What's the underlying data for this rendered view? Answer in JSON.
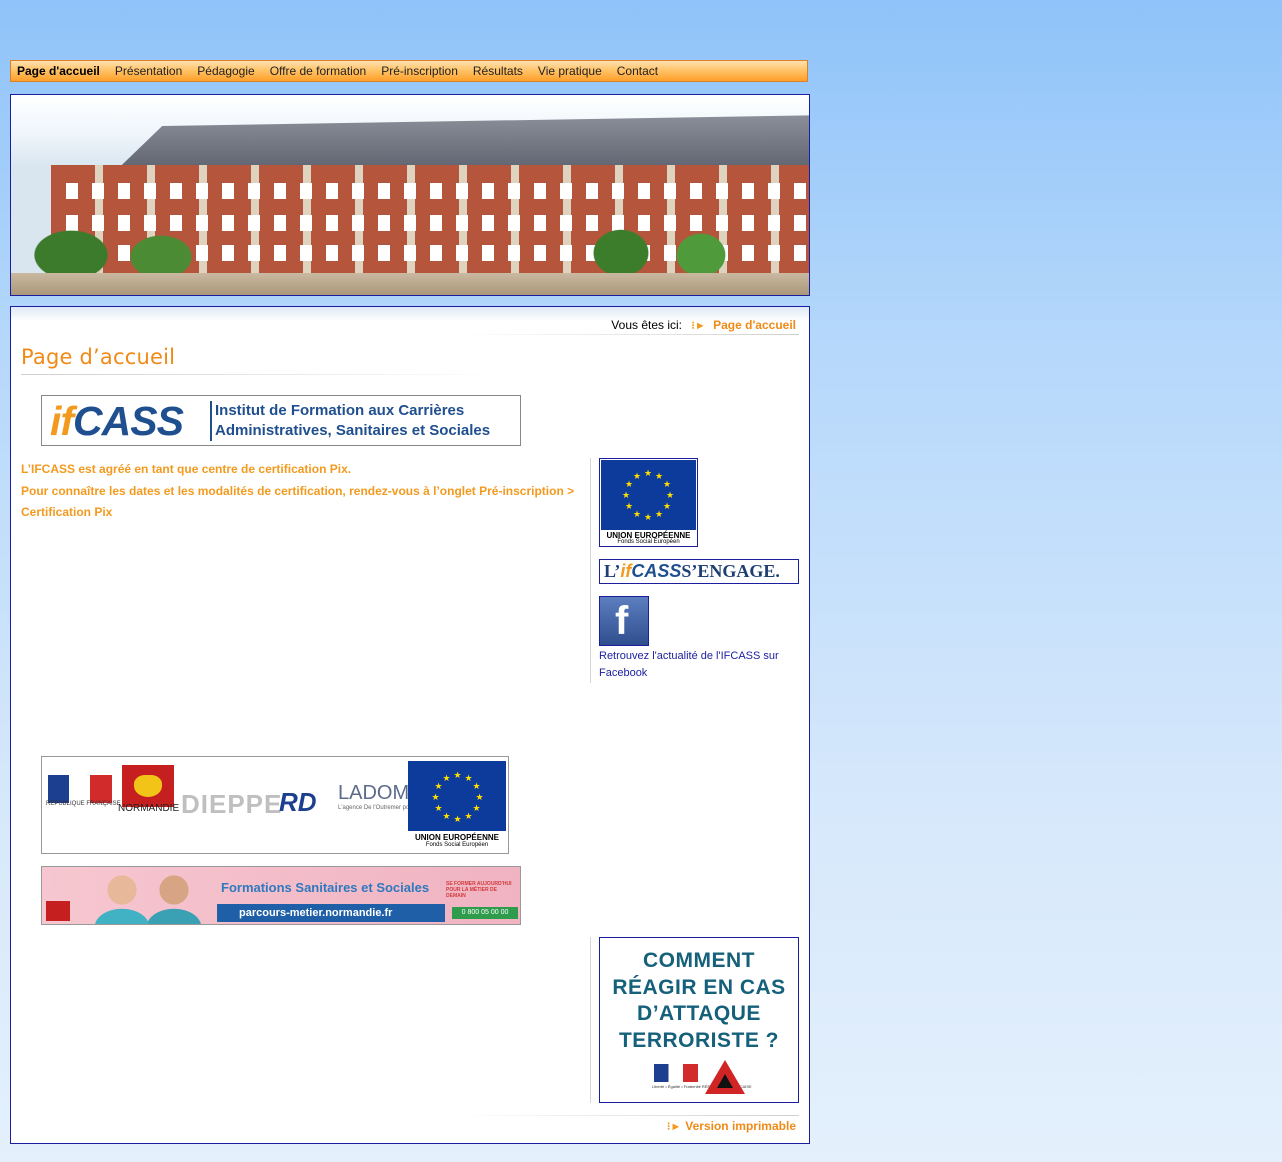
{
  "nav": {
    "items": [
      {
        "label": "Page d'accueil"
      },
      {
        "label": "Présentation"
      },
      {
        "label": "Pédagogie"
      },
      {
        "label": "Offre de formation"
      },
      {
        "label": "Pré-inscription"
      },
      {
        "label": "Résultats"
      },
      {
        "label": "Vie pratique"
      },
      {
        "label": "Contact"
      }
    ],
    "active_index": 0
  },
  "breadcrumb": {
    "prefix": "Vous êtes ici:",
    "current": "Page d'accueil"
  },
  "page_title": "Page d’accueil",
  "logo": {
    "mark_if": "if",
    "mark_cass": "CASS",
    "tagline_1": "Institut de Formation aux Carrières",
    "tagline_2": "Administratives, Sanitaires et Sociales"
  },
  "info": {
    "line_1": "L’IFCASS est agréé en tant que centre de certification Pix.",
    "line_2": "Pour connaître les dates et les modalités de certification, rendez-vous à l’onglet Pré-inscription > Certification Pix"
  },
  "sidebar": {
    "eu_caption_1": "UNION EUROPÉENNE",
    "eu_caption_2": "Fonds Social Européen",
    "engage_prefix": "L’",
    "engage_if": "if",
    "engage_cass": "CASS",
    "engage_suffix": " S’ENGAGE.",
    "facebook_glyph": "f",
    "facebook_text": "Retrouvez l'actualité de l'IFCASS sur Facebook",
    "terror_line_1": "COMMENT",
    "terror_line_2": "RÉAGIR EN CAS",
    "terror_line_3": "D’ATTAQUE",
    "terror_line_4": "TERRORISTE ?",
    "terror_rf": "Liberté • Égalité • Fraternité  RÉPUBLIQUE FRANÇAISE"
  },
  "partners": {
    "rf_text": "RÉPUBLIQUE FRANÇAISE",
    "normandie": "NORMANDIE",
    "dieppe": "DIEPPE",
    "rd": "RD",
    "ladom": "LADOM",
    "ladom_sub": "L'agence De l'Outremer pour la Mobilité",
    "eu_1": "UNION EUROPÉENNE",
    "eu_2": "Fonds Social Européen"
  },
  "formations_banner": {
    "title": "Formations Sanitaires et  Sociales",
    "url": "parcours-metier.normandie.fr",
    "side_text": "SE FORMER AUJOURD'HUI POUR LA MÉTIER DE DEMAIN",
    "phone": "0 800 05 00 00"
  },
  "print_link": "Version imprimable",
  "colors": {
    "accent_orange": "#f08a17",
    "link_blue": "#1b1f9e",
    "border_blue": "#1b1f9e"
  }
}
